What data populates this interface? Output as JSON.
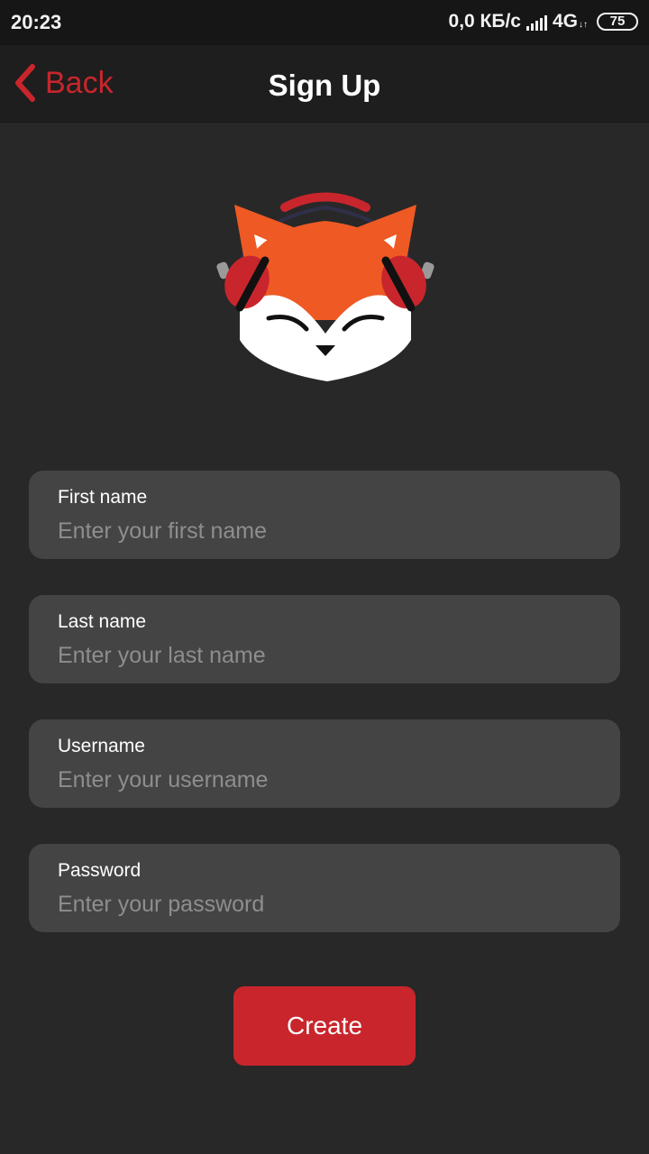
{
  "status_bar": {
    "time": "20:23",
    "network_speed": "0,0 КБ/с",
    "network_type": "4G",
    "network_arrows": "↓↑",
    "battery": "75"
  },
  "header": {
    "back_label": "Back",
    "title": "Sign Up"
  },
  "form": {
    "fields": [
      {
        "label": "First name",
        "placeholder": "Enter your first name",
        "value": ""
      },
      {
        "label": "Last name",
        "placeholder": "Enter your last name",
        "value": ""
      },
      {
        "label": "Username",
        "placeholder": "Enter your username",
        "value": ""
      },
      {
        "label": "Password",
        "placeholder": "Enter your password",
        "value": ""
      }
    ],
    "submit_label": "Create"
  },
  "colors": {
    "accent": "#c8262c",
    "background": "#282828",
    "field_background": "#444444",
    "fox_orange": "#ef5a24"
  },
  "icons": {
    "back": "chevron-left-icon",
    "logo": "fox-headphones-logo"
  }
}
